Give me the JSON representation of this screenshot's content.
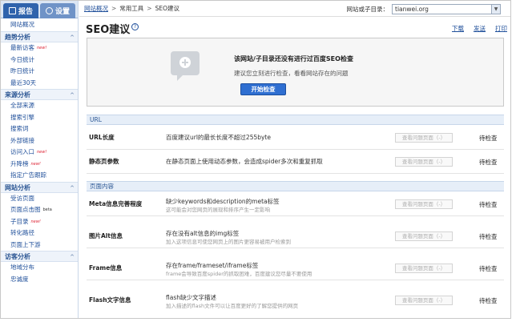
{
  "sidebar": {
    "tabs": [
      {
        "label": "报告",
        "active": true
      },
      {
        "label": "设置",
        "active": false
      }
    ],
    "overview": "网站概况",
    "sections": [
      {
        "title": "趋势分析",
        "items": [
          {
            "label": "最新访客",
            "badge": "new!"
          },
          {
            "label": "今日统计",
            "badge": ""
          },
          {
            "label": "昨日统计",
            "badge": ""
          },
          {
            "label": "最近30天",
            "badge": ""
          }
        ]
      },
      {
        "title": "来源分析",
        "items": [
          {
            "label": "全部来源",
            "badge": ""
          },
          {
            "label": "搜索引擎",
            "badge": ""
          },
          {
            "label": "搜索词",
            "badge": ""
          },
          {
            "label": "外部链接",
            "badge": ""
          },
          {
            "label": "访问入口",
            "badge": "new!"
          },
          {
            "label": "升降榜",
            "badge": "new!"
          },
          {
            "label": "指定广告跟踪",
            "badge": ""
          }
        ]
      },
      {
        "title": "网站分析",
        "items": [
          {
            "label": "受访页面",
            "badge": ""
          },
          {
            "label": "页面点击图",
            "badge": "beta"
          },
          {
            "label": "子目录",
            "badge": "new!"
          },
          {
            "label": "转化路径",
            "badge": ""
          },
          {
            "label": "页面上下游",
            "badge": ""
          }
        ]
      },
      {
        "title": "访客分析",
        "items": [
          {
            "label": "地域分布",
            "badge": ""
          },
          {
            "label": "忠诚度",
            "badge": ""
          }
        ]
      }
    ]
  },
  "breadcrumb": {
    "home": "网站概况",
    "sep1": ">",
    "mid": "常用工具",
    "sep2": ">",
    "current": "SEO建议"
  },
  "site_selector": {
    "label": "网站或子目录：",
    "value": "tianwei.org"
  },
  "page": {
    "title": "SEO建议",
    "help": "?",
    "actions": [
      "下载",
      "发送",
      "打印"
    ]
  },
  "notice": {
    "title": "该网站/子目录还没有进行过百度SEO检查",
    "subtitle": "建议您立刻进行检查，看看网站存在的问题",
    "button": "开始检查"
  },
  "sections": [
    {
      "title": "URL",
      "rows": [
        {
          "name": "URL长度",
          "desc": "百度建议url的最长长度不超过255byte",
          "hint": "",
          "view": "查看问题页面（-）",
          "status": "待检查"
        },
        {
          "name": "静态页参数",
          "desc": "在静态页面上使用动态参数，会造成spider多次和重复抓取",
          "hint": "",
          "view": "查看问题页面（-）",
          "status": "待检查"
        }
      ]
    },
    {
      "title": "页面内容",
      "rows": [
        {
          "name": "Meta信息完善程度",
          "desc": "缺少keywords和description的meta标签",
          "hint": "这可能会对您网页的展现和排序产生一定影响",
          "view": "查看问题页面（-）",
          "status": "待检查"
        },
        {
          "name": "图片Alt信息",
          "desc": "存在没有alt信息的img标签",
          "hint": "加入这项信息可使您网页上的图片更容易被用户检索到",
          "view": "查看问题页面（-）",
          "status": "待检查"
        },
        {
          "name": "Frame信息",
          "desc": "存在frame/frameset/iframe标签",
          "hint": "frame会导致百度spider的抓取困难，百度建议您尽量不要使用",
          "view": "查看问题页面（-）",
          "status": "待检查"
        },
        {
          "name": "Flash文字信息",
          "desc": "flash缺少文字描述",
          "hint": "加入描述的flash文件可以让百度更好的了解您提供的网页",
          "view": "查看问题页面（-）",
          "status": "待检查"
        }
      ]
    }
  ]
}
